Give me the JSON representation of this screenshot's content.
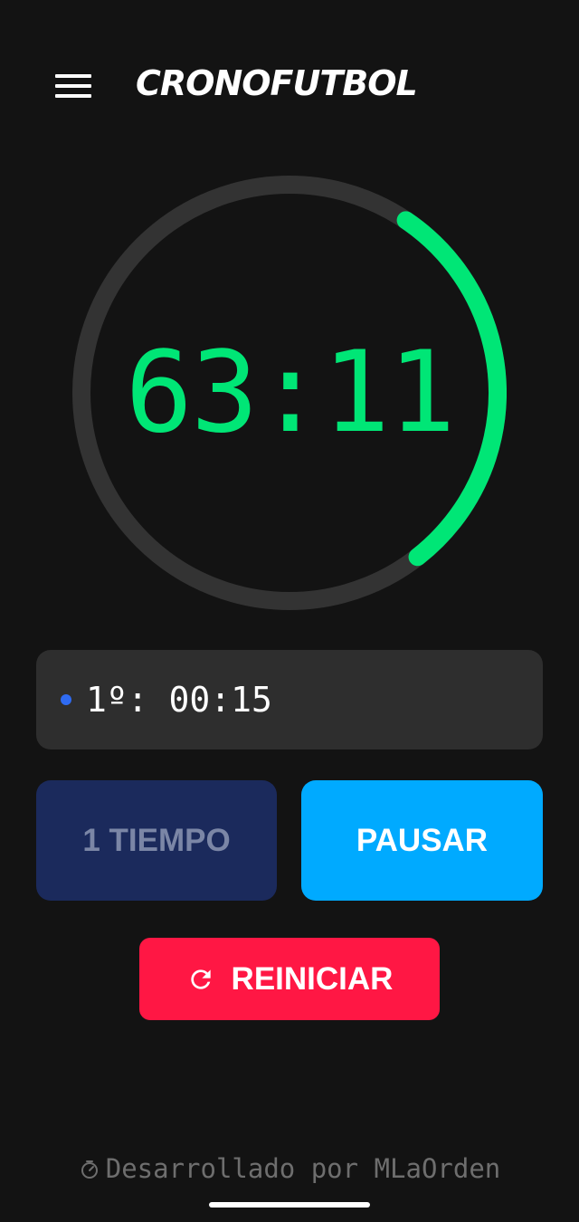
{
  "header": {
    "menu_icon": "hamburger-menu-icon",
    "title": "CRONOFUTBOL"
  },
  "timer": {
    "display": "63:11",
    "progress": 0.3,
    "color": "#00e676",
    "track_color": "#333333"
  },
  "period_status": {
    "indicator_color": "#2f6bf2",
    "text": "1º: 00:15"
  },
  "buttons": {
    "period_label": "1 TIEMPO",
    "pause_label": "PAUSAR",
    "reset_label": "REINICIAR",
    "reset_icon": "refresh-icon"
  },
  "colors": {
    "background": "#131313",
    "period_button": "#1b2a5c",
    "pause_button": "#00aaff",
    "reset_button": "#ff1744"
  },
  "footer": {
    "icon": "timer-icon",
    "text": "Desarrollado por MLaOrden"
  }
}
